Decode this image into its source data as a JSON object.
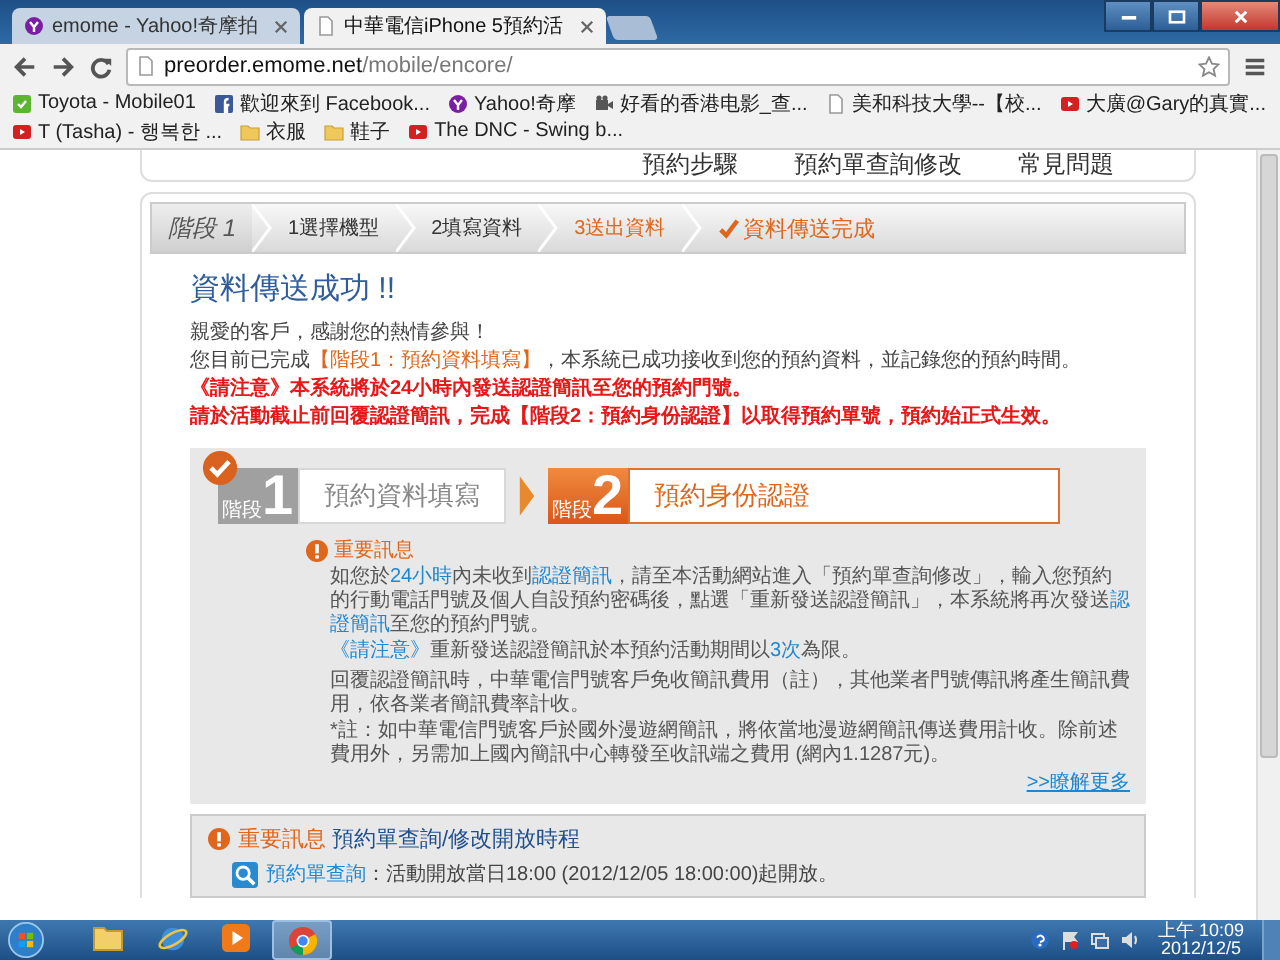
{
  "browser": {
    "tabs": [
      {
        "title": "emome - Yahoo!奇摩拍",
        "kind": "yahoo",
        "selected": false
      },
      {
        "title": "中華電信iPhone 5預約活",
        "kind": "page",
        "selected": true
      }
    ],
    "url_host": "preorder.emome.net",
    "url_path": "/mobile/encore/",
    "bookmarks": [
      {
        "label": "Toyota - Mobile01",
        "kind": "mobile"
      },
      {
        "label": "歡迎來到 Facebook...",
        "kind": "facebook"
      },
      {
        "label": "Yahoo!奇摩",
        "kind": "yahoo"
      },
      {
        "label": "好看的香港电影_查...",
        "kind": "film"
      },
      {
        "label": "美和科技大學--【校...",
        "kind": "page"
      },
      {
        "label": "大廣@Gary的真實...",
        "kind": "video"
      },
      {
        "label": "T (Tasha) - 행복한 ...",
        "kind": "video"
      },
      {
        "label": "衣服",
        "kind": "folder"
      },
      {
        "label": "鞋子",
        "kind": "folder"
      },
      {
        "label": "The DNC - Swing b...",
        "kind": "video"
      }
    ]
  },
  "top_nav": [
    "預約步驟",
    "預約單查詢修改",
    "常見問題"
  ],
  "step_bar": {
    "stage_label": "階段 1",
    "steps": [
      {
        "label": "1選擇機型",
        "kind": "plain"
      },
      {
        "label": "2填寫資料",
        "kind": "plain"
      },
      {
        "label": "3送出資料",
        "kind": "current"
      },
      {
        "label": "資料傳送完成",
        "kind": "complete"
      }
    ]
  },
  "heading": "資料傳送成功 !!",
  "messages": [
    [
      {
        "text": "親愛的客戶，感謝您的熱情參與！",
        "kind": "normal"
      }
    ],
    [
      {
        "text": "您目前已完成",
        "kind": "normal"
      },
      {
        "text": "【階段1：預約資料填寫】",
        "kind": "orange"
      },
      {
        "text": "，本系統已成功接收到您的預約資料，並記錄您的預約時間。",
        "kind": "normal"
      }
    ],
    [
      {
        "text": "《請注意》本系統將於24小時內發送認證簡訊至您的預約門號。",
        "kind": "red"
      }
    ],
    [
      {
        "text": "請於活動截止前回覆認證簡訊，完成【階段2：預約身份認證】以取得預約單號，預約始正式生效。",
        "kind": "red"
      }
    ]
  ],
  "stages": [
    {
      "badge_label": "階段",
      "number": "1",
      "title": "預約資料填寫",
      "selected": false,
      "checked": true
    },
    {
      "badge_label": "階段",
      "number": "2",
      "title": "預約身份認證",
      "selected": true,
      "checked": false
    }
  ],
  "notice": {
    "heading": "重要訊息",
    "paragraphs": [
      [
        {
          "text": "如您於",
          "kind": "normal"
        },
        {
          "text": "24小時",
          "kind": "blue"
        },
        {
          "text": "內未收到",
          "kind": "normal"
        },
        {
          "text": "認證簡訊",
          "kind": "blue"
        },
        {
          "text": "，請至本活動網站進入「預約單查詢修改」，輸入您預約的行動電話門號及個人自設預約密碼後，點選「重新發送認證簡訊」，本系統將再次發送",
          "kind": "normal"
        },
        {
          "text": "認證簡訊",
          "kind": "blue"
        },
        {
          "text": "至您的預約門號。",
          "kind": "normal"
        }
      ],
      [
        {
          "text": "《請注意》",
          "kind": "blue"
        },
        {
          "text": "重新發送認證簡訊於本預約活動期間以",
          "kind": "normal"
        },
        {
          "text": "3次",
          "kind": "blue"
        },
        {
          "text": "為限。",
          "kind": "normal"
        }
      ],
      [
        {
          "text": "回覆認證簡訊時，中華電信門號客戶免收簡訊費用（註），其他業者門號傳訊將產生簡訊費用，依各業者簡訊費率計收。",
          "kind": "normal"
        }
      ],
      [
        {
          "text": "*註：如中華電信門號客戶於國外漫遊網簡訊，將依當地漫遊網簡訊傳送費用計收。除前述費用外，另需加上國內簡訊中心轉發至收訊端之費用 (網內1.1287元)。",
          "kind": "normal"
        }
      ]
    ],
    "more_link": ">>瞭解更多"
  },
  "schedule": {
    "heading": [
      {
        "text": "重要訊息",
        "kind": "orange"
      },
      {
        "text": " 預約單查詢/修改開放時程",
        "kind": "navy"
      }
    ],
    "item": [
      {
        "text": "預約單查詢",
        "kind": "blue"
      },
      {
        "text": "：活動開放當日18:00 (2012/12/05 18:00:00)起開放。",
        "kind": "normal"
      }
    ]
  },
  "taskbar": {
    "apps": [
      {
        "kind": "explorer",
        "selected": false
      },
      {
        "kind": "ie",
        "selected": false
      },
      {
        "kind": "media",
        "selected": false
      },
      {
        "kind": "chrome",
        "selected": true
      }
    ],
    "time": "上午 10:09",
    "date": "2012/12/5"
  }
}
